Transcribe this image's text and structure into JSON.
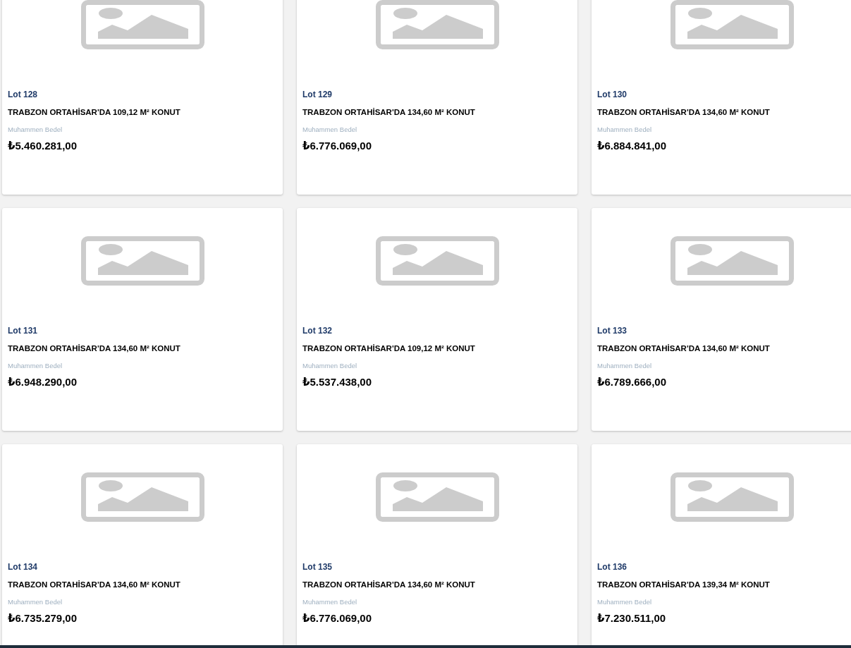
{
  "lots": [
    {
      "lot": "Lot 128",
      "title": "TRABZON ORTAHİSAR'DA 109,12 M² KONUT",
      "label": "Muhammen Bedel",
      "price": "₺5.460.281,00"
    },
    {
      "lot": "Lot 129",
      "title": "TRABZON ORTAHİSAR'DA 134,60 M² KONUT",
      "label": "Muhammen Bedel",
      "price": "₺6.776.069,00"
    },
    {
      "lot": "Lot 130",
      "title": "TRABZON ORTAHİSAR'DA 134,60 M² KONUT",
      "label": "Muhammen Bedel",
      "price": "₺6.884.841,00"
    },
    {
      "lot": "Lot 131",
      "title": "TRABZON ORTAHİSAR'DA 134,60 M² KONUT",
      "label": "Muhammen Bedel",
      "price": "₺6.948.290,00"
    },
    {
      "lot": "Lot 132",
      "title": "TRABZON ORTAHİSAR'DA 109,12 M² KONUT",
      "label": "Muhammen Bedel",
      "price": "₺5.537.438,00"
    },
    {
      "lot": "Lot 133",
      "title": "TRABZON ORTAHİSAR'DA 134,60 M² KONUT",
      "label": "Muhammen Bedel",
      "price": "₺6.789.666,00"
    },
    {
      "lot": "Lot 134",
      "title": "TRABZON ORTAHİSAR'DA 134,60 M² KONUT",
      "label": "Muhammen Bedel",
      "price": "₺6.735.279,00"
    },
    {
      "lot": "Lot 135",
      "title": "TRABZON ORTAHİSAR'DA 134,60 M² KONUT",
      "label": "Muhammen Bedel",
      "price": "₺6.776.069,00"
    },
    {
      "lot": "Lot 136",
      "title": "TRABZON ORTAHİSAR'DA 139,34 M² KONUT",
      "label": "Muhammen Bedel",
      "price": "₺7.230.511,00"
    }
  ]
}
